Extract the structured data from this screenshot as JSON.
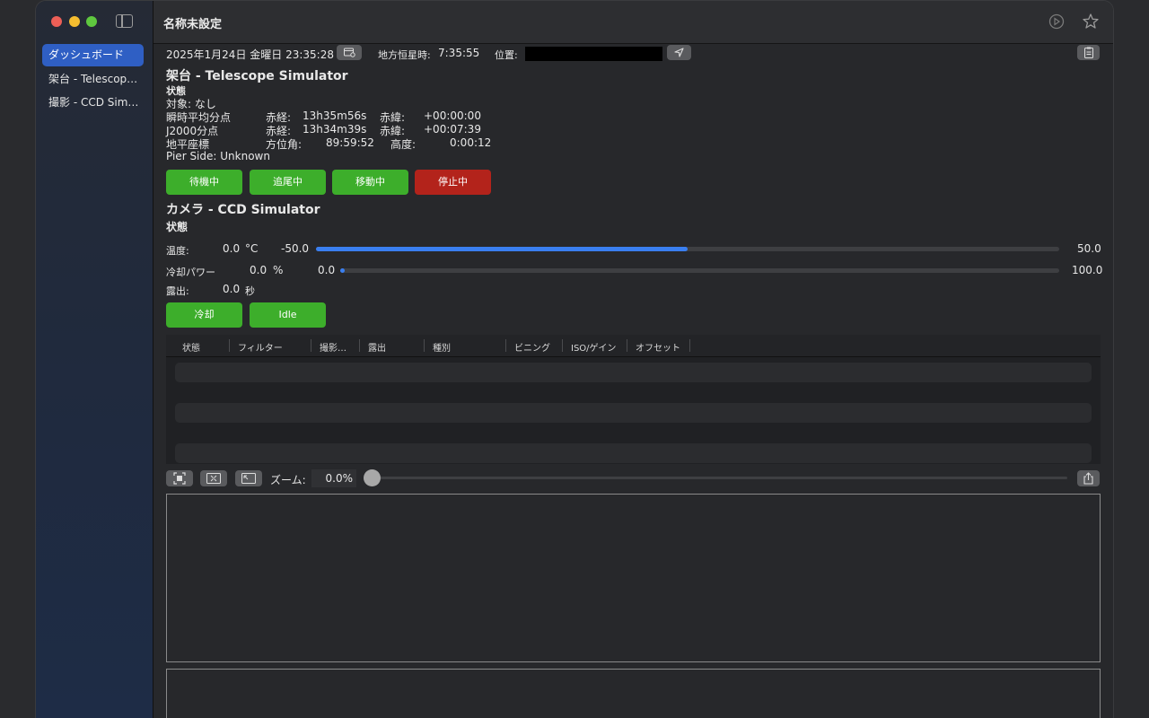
{
  "window": {
    "title": "名称未設定"
  },
  "sidebar": {
    "items": [
      {
        "label": "ダッシュボード",
        "selected": true
      },
      {
        "label": "架台 - Telescope Simulator"
      },
      {
        "label": "撮影 - CCD Simulator"
      }
    ]
  },
  "topbar": {
    "datetime": "2025年1月24日 金曜日 23:35:28",
    "sidereal_label": "地方恒星時:",
    "sidereal_value": "7:35:55",
    "location_label": "位置:",
    "location_value": ""
  },
  "mount": {
    "heading": "架台 -  Telescope Simulator",
    "status_label": "状態",
    "target": "対象:  なし",
    "rows": [
      {
        "label": "瞬時平均分点",
        "a_label": "赤経:",
        "a_value": "13h35m56s",
        "b_label": "赤緯:",
        "b_value": "+00:00:00"
      },
      {
        "label": "J2000分点",
        "a_label": "赤経:",
        "a_value": "13h34m39s",
        "b_label": "赤緯:",
        "b_value": "+00:07:39"
      },
      {
        "label": "地平座標",
        "a_label": "方位角:",
        "a_value": "89:59:52",
        "b_label": "高度:",
        "b_value": "0:00:12"
      }
    ],
    "pier_side": "Pier Side: Unknown",
    "buttons": [
      "待機中",
      "追尾中",
      "移動中",
      "停止中"
    ]
  },
  "camera": {
    "heading": "カメラ -  CCD Simulator",
    "status_label": "状態",
    "temperature": {
      "label": "温度:",
      "value": "0.0",
      "unit": "°C",
      "min": "-50.0",
      "max": "50.0",
      "fraction": 0.5
    },
    "cooler_power": {
      "label": "冷却パワー",
      "value": "0.0",
      "unit": "%",
      "min": "0.0",
      "max": "100.0",
      "fraction": 0.0
    },
    "exposure": {
      "label": "露出:",
      "value": "0.0",
      "unit": "秒"
    },
    "buttons": [
      "冷却",
      "Idle"
    ]
  },
  "table": {
    "columns": [
      "状態",
      "フィルター",
      "撮影…",
      "露出",
      "種別",
      "ビニング",
      "ISO/ゲイン",
      "オフセット"
    ]
  },
  "zoom": {
    "label": "ズーム:",
    "value": "0.0%"
  },
  "colors": {
    "accent": "#2f5fc4",
    "green": "#3dae2b",
    "red": "#b3231b",
    "progress": "#3a7ff0"
  }
}
